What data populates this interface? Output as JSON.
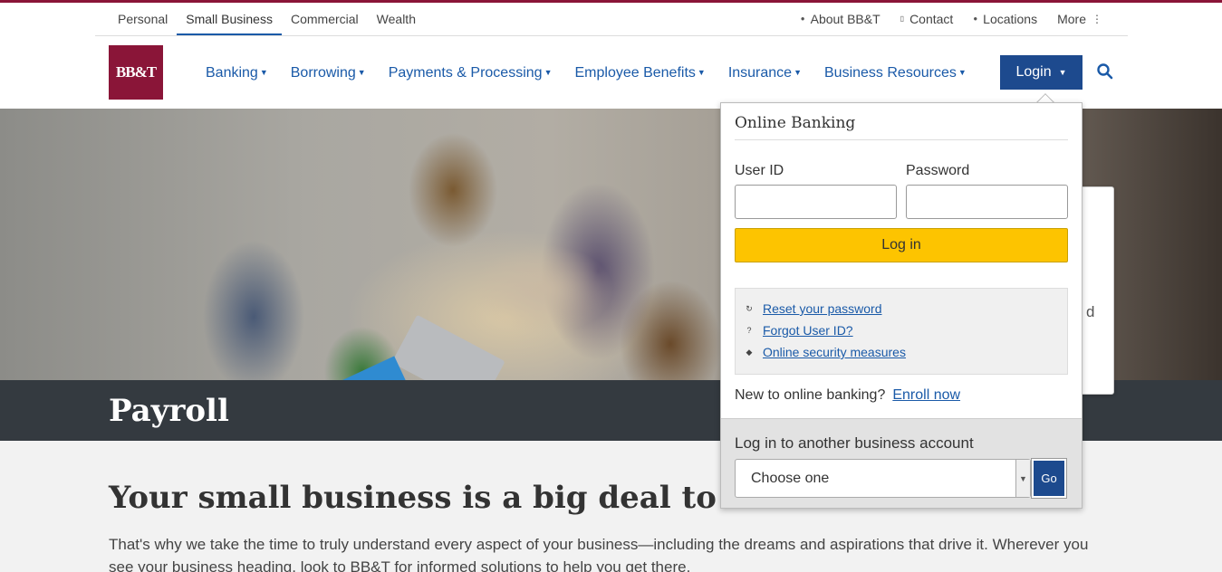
{
  "brand": {
    "logo_text": "BB&T",
    "accent_color": "#8a1538",
    "link_color": "#1a5aa8",
    "primary_button_color": "#1d4a8e",
    "cta_color": "#fdc400"
  },
  "segments": [
    {
      "label": "Personal"
    },
    {
      "label": "Small Business",
      "active": true
    },
    {
      "label": "Commercial"
    },
    {
      "label": "Wealth"
    }
  ],
  "utility_links": [
    {
      "label": "About BB&T",
      "icon": "person-icon"
    },
    {
      "label": "Contact",
      "icon": "phone-icon"
    },
    {
      "label": "Locations",
      "icon": "map-pin-icon"
    },
    {
      "label": "More",
      "icon": "more-vertical-icon"
    }
  ],
  "main_nav": [
    {
      "label": "Banking"
    },
    {
      "label": "Borrowing"
    },
    {
      "label": "Payments & Processing"
    },
    {
      "label": "Employee Benefits"
    },
    {
      "label": "Insurance"
    },
    {
      "label": "Business Resources"
    }
  ],
  "login_button": {
    "label": "Login"
  },
  "hero": {
    "page_title": "Payroll"
  },
  "content": {
    "headline": "Your small business is a big deal to us",
    "body": "That's why we take the time to truly understand every aspect of your business—including the dreams and aspirations that drive it. Wherever you see your business heading, look to BB&T for informed solutions to help you get there."
  },
  "background_card_fragment": "d",
  "login_panel": {
    "title": "Online Banking",
    "user_id_label": "User ID",
    "password_label": "Password",
    "user_id_value": "",
    "password_value": "",
    "submit_label": "Log in",
    "help_links": [
      {
        "label": "Reset your password",
        "icon": "reset-icon"
      },
      {
        "label": "Forgot User ID?",
        "icon": "question-icon"
      },
      {
        "label": "Online security measures",
        "icon": "shield-icon"
      }
    ],
    "enroll_prompt": "New to online banking?",
    "enroll_link": "Enroll now",
    "other_account_label": "Log in to another business account",
    "select_value": "Choose one",
    "go_label": "Go"
  }
}
